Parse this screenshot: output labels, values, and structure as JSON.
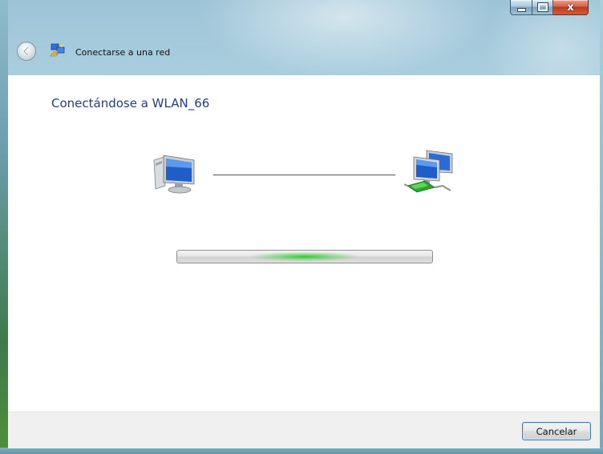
{
  "window": {
    "title": "Conectarse a una red"
  },
  "caption_buttons": {
    "minimize": "minimize-icon",
    "maximize": "maximize-icon",
    "close": "close-icon",
    "close_glyph": "x"
  },
  "nav": {
    "back_icon": "back-arrow-icon",
    "app_icon": "network-connect-icon"
  },
  "content": {
    "heading": "Conectándose a WLAN_66",
    "local_icon": "computer-icon",
    "remote_icon": "network-icon",
    "progress_state": "indeterminate"
  },
  "footer": {
    "cancel_label": "Cancelar"
  },
  "colors": {
    "heading": "#1e3e8c",
    "progress_glow": "#28c828",
    "button_focus_border": "#3c7fb1"
  }
}
